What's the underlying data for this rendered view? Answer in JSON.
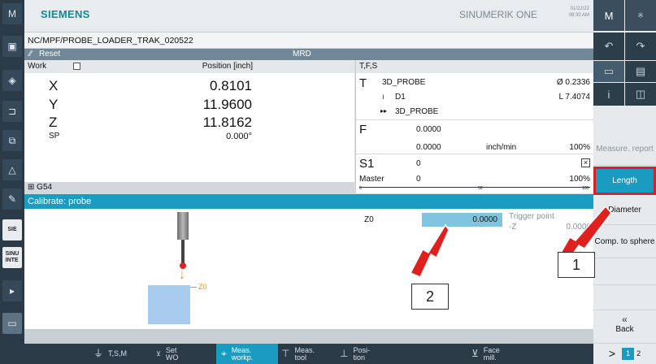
{
  "header": {
    "brand": "SIEMENS",
    "product": "SINUMERIK ONE",
    "date": "01/22/22",
    "time": "08:30 AM"
  },
  "program_path": "NC/MPF/PROBE_LOADER_TRAK_020522",
  "status": {
    "reset": "Reset",
    "mode": "MRD"
  },
  "position": {
    "header_label": "Work",
    "header_title": "Position [inch]",
    "axes": [
      {
        "name": "X",
        "value": "0.8101"
      },
      {
        "name": "Y",
        "value": "11.9600"
      },
      {
        "name": "Z",
        "value": "11.8162"
      },
      {
        "name": "SP",
        "value": "0.000°"
      }
    ],
    "work_offset": "G54"
  },
  "tfs": {
    "title": "T,F,S",
    "t_label": "T",
    "tool_name": "3D_PROBE",
    "tool_diameter": "Ø 0.2336",
    "d_label": "D1",
    "tool_length": "L 7.4074",
    "next_tool": "3D_PROBE",
    "f_label": "F",
    "feed1": "0.0000",
    "feed2": "0.0000",
    "feed_unit": "inch/min",
    "feed_pct": "100%",
    "s_label": "S1",
    "spindle_speed": "0",
    "master_label": "Master",
    "master_value": "0",
    "master_pct": "100%",
    "scale_mid": "50",
    "scale_zero": "0",
    "scale_max": "100"
  },
  "calibrate": {
    "title": "Calibrate: probe",
    "z0_label": "Z0",
    "z0_value": "0.0000",
    "trigger_label": "Trigger point",
    "trigger_axis": "-Z",
    "trigger_value": "0.0000",
    "diagram_z0": "Z0"
  },
  "right_softkeys": {
    "measure_report": "Measure. report",
    "length": "Length",
    "diameter": "Diameter",
    "comp_sphere": "Comp. to sphere",
    "back": "Back"
  },
  "bottom_softkeys": [
    {
      "label": "T,S,M",
      "icon": "tsm-icon"
    },
    {
      "label": "Set WO",
      "icon": "set-wo-icon"
    },
    {
      "label": "Meas. workp.",
      "icon": "meas-workpiece-icon"
    },
    {
      "label": "Meas. tool",
      "icon": "meas-tool-icon"
    },
    {
      "label": "Posi- tion",
      "icon": "position-icon"
    },
    {
      "label": "Face mill.",
      "icon": "face-mill-icon"
    }
  ],
  "pager": {
    "page1": "1",
    "page2": "2"
  },
  "callouts": {
    "one": "1",
    "two": "2"
  },
  "colors": {
    "accent": "#1a9bc2",
    "brand": "#0e8a99",
    "arrow": "#e0201f"
  }
}
